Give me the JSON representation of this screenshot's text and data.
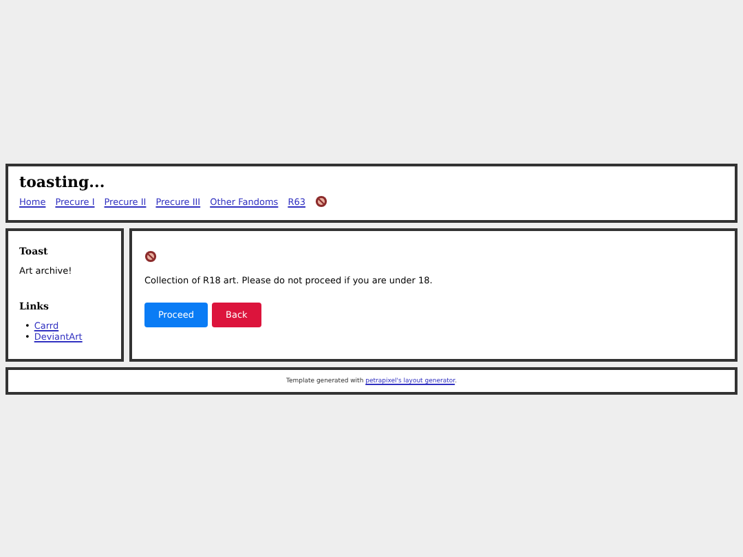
{
  "header": {
    "title": "toasting...",
    "nav": [
      {
        "label": "Home",
        "kind": "link"
      },
      {
        "label": "Precure I",
        "kind": "link"
      },
      {
        "label": "Precure II",
        "kind": "link"
      },
      {
        "label": "Precure III",
        "kind": "link"
      },
      {
        "label": "Other Fandoms",
        "kind": "link"
      },
      {
        "label": "R63",
        "kind": "link"
      },
      {
        "kind": "adult-icon"
      }
    ]
  },
  "sidebar": {
    "sections": [
      {
        "heading": "Toast",
        "text": "Art archive!"
      },
      {
        "heading": "Links",
        "links": [
          {
            "bullet": "•",
            "label": "Carrd"
          },
          {
            "bullet": "•",
            "label": "DeviantArt"
          }
        ]
      }
    ]
  },
  "main": {
    "text": "Collection of R18 art. Please do not proceed if you are under 18.",
    "buttons": [
      {
        "label": "Proceed",
        "color": "#0a7cf5"
      },
      {
        "label": "Back",
        "color": "#dc143c"
      }
    ]
  },
  "footer": {
    "text": "Template generated with",
    "link": "petrapixel's layout generator",
    "end": "."
  }
}
